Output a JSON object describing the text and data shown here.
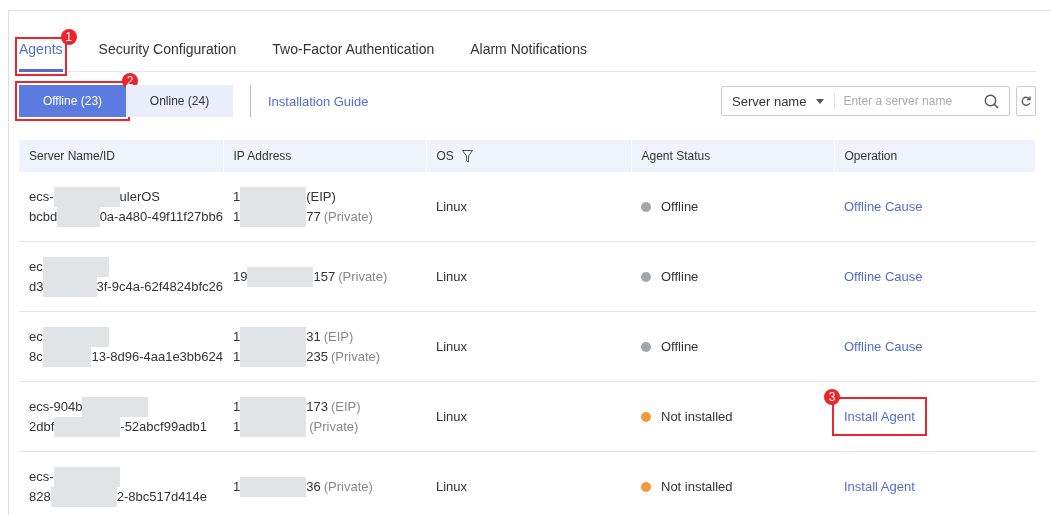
{
  "tabs": [
    {
      "label": "Agents",
      "selected": true,
      "callout": "1"
    },
    {
      "label": "Security Configuration",
      "selected": false
    },
    {
      "label": "Two-Factor Authentication",
      "selected": false
    },
    {
      "label": "Alarm Notifications",
      "selected": false
    }
  ],
  "filters": [
    {
      "label": "Offline (23)",
      "selected": true,
      "callout": "2"
    },
    {
      "label": "Online (24)",
      "selected": false
    }
  ],
  "guide_link": "Installation Guide",
  "search": {
    "selector": "Server name",
    "placeholder": "Enter a server name"
  },
  "table": {
    "columns": [
      "Server Name/ID",
      "IP Address",
      "OS",
      "Agent Status",
      "Operation"
    ],
    "rows": [
      {
        "name": {
          "start": "ecs-",
          "end": "ulerOS"
        },
        "id": {
          "start": "bcbd",
          "end": "0a-a480-49f11f27bb6"
        },
        "ips": [
          {
            "start": "1",
            "end": "(EIP)"
          },
          {
            "start": "1",
            "end": "77",
            "suffix": "(Private)"
          }
        ],
        "os": "Linux",
        "status": "Offline",
        "color": "#a3a5ad",
        "operation": "Offline Cause"
      },
      {
        "name": {
          "start": "ec"
        },
        "id": {
          "start": "d3",
          "end": "3f-9c4a-62f4824bfc26"
        },
        "ips": [
          {
            "start": "19",
            "end": "157",
            "suffix": "(Private)"
          }
        ],
        "os": "Linux",
        "status": "Offline",
        "color": "#a3a5ad",
        "operation": "Offline Cause"
      },
      {
        "name": {
          "start": "ec"
        },
        "id": {
          "start": "8c",
          "end": "13-8d96-4aa1e3bb624"
        },
        "ips": [
          {
            "start": "1",
            "end": "31",
            "suffix": "(EIP)"
          },
          {
            "start": "1",
            "end": "235",
            "suffix": "(Private)"
          }
        ],
        "os": "Linux",
        "status": "Offline",
        "color": "#a3a5ad",
        "operation": "Offline Cause"
      },
      {
        "name": {
          "start": "ecs-904b"
        },
        "id": {
          "start": "2dbf",
          "end": "-52abcf99adb1"
        },
        "ips": [
          {
            "start": "1",
            "end": "173",
            "suffix": "(EIP)"
          },
          {
            "start": "1",
            "suffix": "(Private)"
          }
        ],
        "os": "Linux",
        "status": "Not installed",
        "color": "#f39a3a",
        "operation": "Install Agent",
        "callout": "3"
      },
      {
        "name": {
          "start": "ecs-"
        },
        "id": {
          "start": "828",
          "end": "2-8bc517d414e"
        },
        "ips": [
          {
            "start": "1",
            "end": "36",
            "suffix": "(Private)"
          }
        ],
        "os": "Linux",
        "status": "Not installed",
        "color": "#f39a3a",
        "operation": "Install Agent"
      }
    ]
  }
}
